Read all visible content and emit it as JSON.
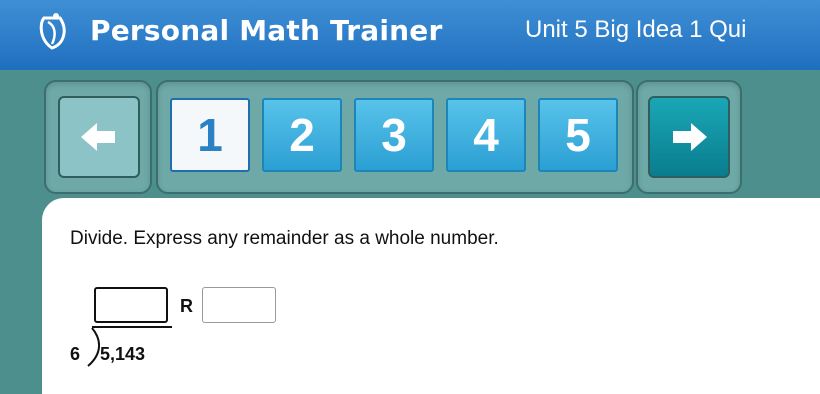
{
  "header": {
    "app_title": "Personal Math Trainer",
    "quiz_title": "Unit 5 Big Idea 1 Qui"
  },
  "nav": {
    "questions": [
      {
        "label": "1",
        "active": true
      },
      {
        "label": "2",
        "active": false
      },
      {
        "label": "3",
        "active": false
      },
      {
        "label": "4",
        "active": false
      },
      {
        "label": "5",
        "active": false
      }
    ],
    "prev_icon": "left-arrow-icon",
    "next_icon": "right-arrow-icon"
  },
  "question": {
    "instructions": "Divide. Express any remainder as a whole number.",
    "remainder_label": "R",
    "divisor": "6",
    "dividend": "5,143",
    "quotient_value": "",
    "remainder_value": ""
  },
  "colors": {
    "header_blue": "#1f6fbf",
    "nav_bg": "#4c8f8c",
    "question_button": "#2b9fd3",
    "next_button": "#0a7d8e"
  }
}
